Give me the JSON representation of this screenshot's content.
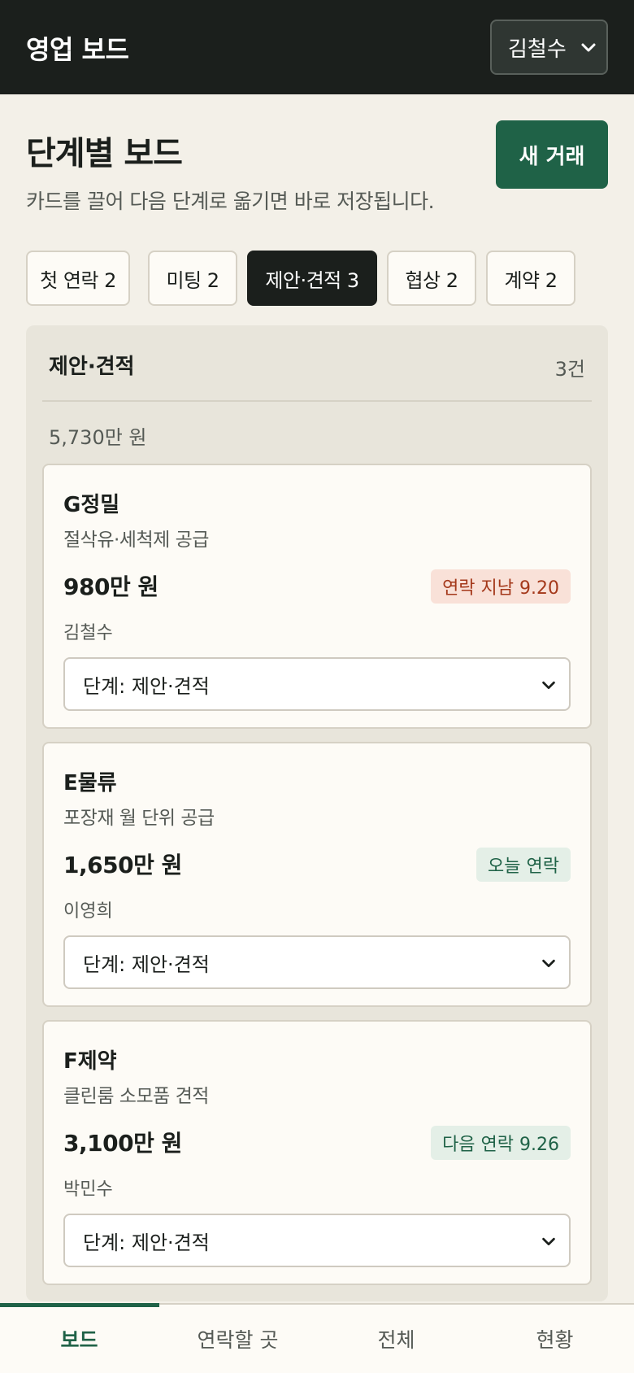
{
  "header": {
    "app_title": "영업 보드",
    "user_select": {
      "value": "김철수",
      "icon": "chevron-down-icon"
    }
  },
  "page": {
    "title": "단계별 보드",
    "subtitle": "카드를 끌어 다음 단계로 옮기면 바로 저장됩니다.",
    "new_deal_label": "새 거래"
  },
  "stage_tabs": [
    {
      "label": "첫 연락 2",
      "active": false
    },
    {
      "label": "미팅 2",
      "active": false
    },
    {
      "label": "제안·견적 3",
      "active": true
    },
    {
      "label": "협상 2",
      "active": false
    },
    {
      "label": "계약 2",
      "active": false
    }
  ],
  "column": {
    "title": "제안·견적",
    "count": "3건",
    "total": "5,730만 원"
  },
  "cards": [
    {
      "company": "G정밀",
      "description": "절삭유·세척제 공급",
      "amount": "980만 원",
      "badge": "연락 지남 9.20",
      "badge_status": "overdue",
      "owner": "김철수",
      "stage_select": "단계: 제안·견적"
    },
    {
      "company": "E물류",
      "description": "포장재 월 단위 공급",
      "amount": "1,650만 원",
      "badge": "오늘 연락",
      "badge_status": "today",
      "owner": "이영희",
      "stage_select": "단계: 제안·견적"
    },
    {
      "company": "F제약",
      "description": "클린룸 소모품 견적",
      "amount": "3,100만 원",
      "badge": "다음 연락 9.26",
      "badge_status": "next",
      "owner": "박민수",
      "stage_select": "단계: 제안·견적"
    }
  ],
  "bottom_nav": [
    {
      "label": "보드",
      "active": true
    },
    {
      "label": "연락할 곳",
      "active": false
    },
    {
      "label": "전체",
      "active": false
    },
    {
      "label": "현황",
      "active": false
    }
  ],
  "colors": {
    "header_bg": "#1b1f1c",
    "accent_green": "#1f6247",
    "overdue_bg": "#f9e1d8",
    "overdue_text": "#a4381a",
    "page_bg": "#f3f0e8"
  }
}
